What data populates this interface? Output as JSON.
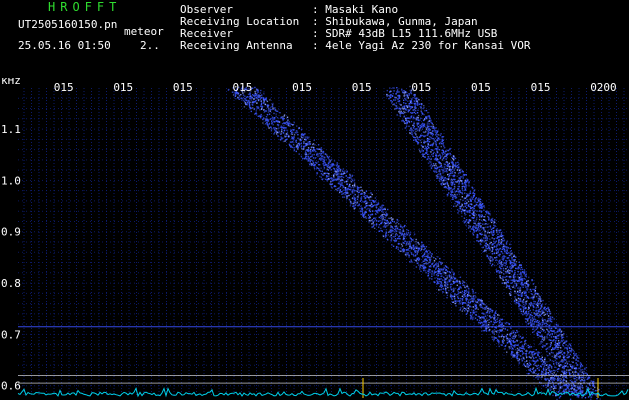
{
  "header": {
    "app_title": "HROFFT",
    "file_name": "UT2505160150.pn",
    "file_tag": "meteor",
    "datetime": "25.05.16 01:50",
    "extra": "2..",
    "meta": [
      {
        "label": "Observer",
        "value": ": Masaki Kano"
      },
      {
        "label": "Receiving Location",
        "value": ": Shibukawa, Gunma, Japan"
      },
      {
        "label": "Receiver",
        "value": ": SDR# 43dB L15 111.6MHz USB"
      },
      {
        "label": "Receiving Antenna",
        "value": ": 4ele Yagi Az 230 for Kansai VOR"
      }
    ]
  },
  "colors": {
    "background": "#000000",
    "grid": "#0f1f78",
    "signal": "#3a55ff",
    "baseline": "#00cfe8",
    "title": "#2fdc2f"
  },
  "chart_data": {
    "type": "heatmap",
    "ylabel": "kHz",
    "ylim": [
      0.58,
      1.18
    ],
    "y_ticks": [
      0.6,
      0.7,
      0.8,
      0.9,
      1.0,
      1.1
    ],
    "x_ticks": [
      "015",
      "015",
      "015",
      "015",
      "015",
      "015",
      "015",
      "015",
      "015",
      "0200"
    ],
    "x_minutes": [
      0,
      1,
      2,
      3,
      4,
      5,
      6,
      7,
      8,
      9
    ],
    "xlim": [
      -0.75,
      9.5
    ],
    "carriers_khz": [
      0.715,
      0.62,
      0.605
    ],
    "traces": [
      {
        "start": [
          3.0,
          1.18
        ],
        "end": [
          8.5,
          0.58
        ]
      },
      {
        "start": [
          5.6,
          1.18
        ],
        "end": [
          8.8,
          0.58
        ]
      }
    ]
  }
}
